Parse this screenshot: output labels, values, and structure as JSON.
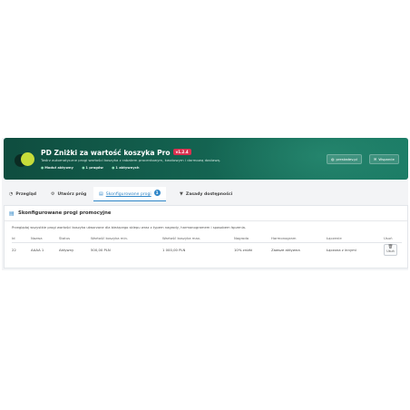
{
  "header": {
    "title": "PD Zniżki za wartość koszyka Pro",
    "version": "v1.2.4",
    "subtitle": "Twórz automatyczne progi wartości koszyka z rabatem procentowym, kwotowym i darmową dostawą.",
    "stats": [
      "Moduł aktywny",
      "1 progów",
      "1 aktywnych"
    ],
    "buttons": [
      {
        "label": "prestadev.pl",
        "icon": "globe-icon"
      },
      {
        "label": "Wsparcie",
        "icon": "mail-icon"
      }
    ]
  },
  "tabs": [
    {
      "label": "Przegląd",
      "icon": "dashboard-icon",
      "active": false
    },
    {
      "label": "Utwórz próg",
      "icon": "gear-icon",
      "active": false
    },
    {
      "label": "Skonfigurowane progi",
      "icon": "list-icon",
      "active": true,
      "badge": "1"
    },
    {
      "label": "Zasady dostępności",
      "icon": "filter-icon",
      "active": false
    }
  ],
  "card": {
    "title": "Skonfigurowane progi promocyjne",
    "description": "Przeglądaj wszystkie progi wartości koszyka utworzone dla bieżącego sklepu wraz z typem nagrody, harmonogramem i sposobem łączenia.",
    "columns": [
      "Id",
      "Nazwa",
      "Status",
      "Wartość koszyka min.",
      "Wartość koszyka max.",
      "Nagroda",
      "Harmonogram",
      "Łączenie",
      "Usuń"
    ],
    "rows": [
      {
        "id": "22",
        "name": "AAAA 1",
        "status": "Aktywny",
        "min": "500,00 PLN",
        "max": "1 000,00 PLN",
        "reward": "10% zniżki",
        "schedule": "Zawsze aktywna",
        "combine": "Łączona z innymi",
        "delete_label": "Usuń"
      }
    ]
  },
  "colors": {
    "banner_start": "#0f4d3f",
    "banner_end": "#1a7a64",
    "accent": "#2f86c8",
    "version_badge": "#d9304f",
    "logo_lime": "#c6dc3a"
  }
}
